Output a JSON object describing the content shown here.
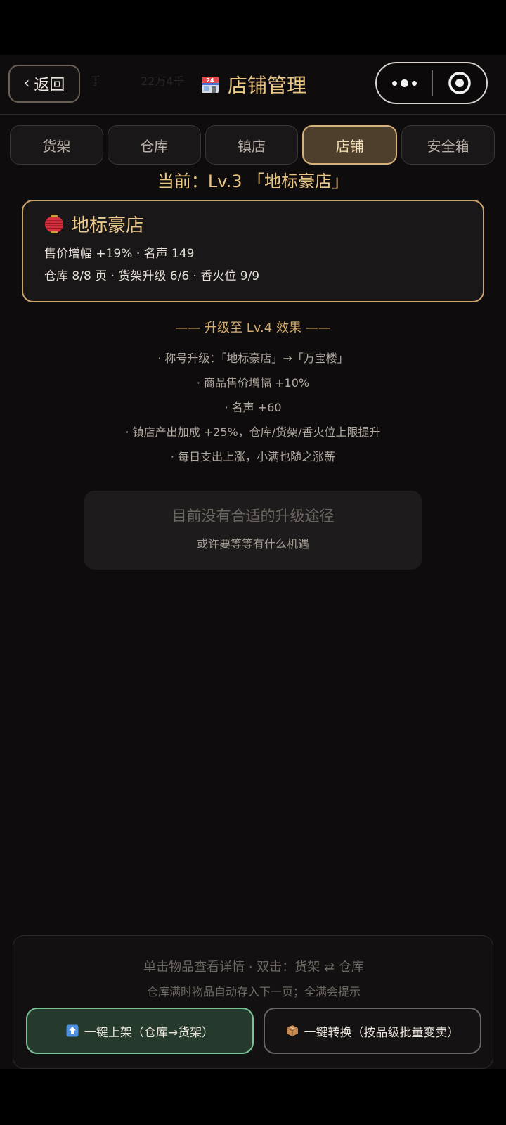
{
  "header": {
    "back_label": "返回",
    "title": "店铺管理",
    "behind_text_1": "手",
    "behind_text_2": "22万4千"
  },
  "tabs": [
    {
      "label": "货架",
      "active": false
    },
    {
      "label": "仓库",
      "active": false
    },
    {
      "label": "镇店",
      "active": false
    },
    {
      "label": "店铺",
      "active": true
    },
    {
      "label": "安全箱",
      "active": false
    }
  ],
  "current_level": "当前：Lv.3 「地标豪店」",
  "shop_card": {
    "name": "地标豪店",
    "stats_line1": "售价增幅 +19% · 名声 149",
    "stats_line2": "仓库 8/8 页 · 货架升级 6/6 · 香火位 9/9"
  },
  "upgrade": {
    "heading": "—— 升级至 Lv.4 效果 ——",
    "effects": [
      "· 称号升级：「地标豪店」→「万宝楼」",
      "· 商品售价增幅 +10%",
      "· 名声 +60",
      "· 镇店产出加成 +25%，仓库/货架/香火位上限提升",
      "· 每日支出上涨，小满也随之涨薪"
    ]
  },
  "no_path": {
    "title": "目前没有合适的升级途径",
    "subtitle": "或许要等等有什么机遇"
  },
  "bottom": {
    "hint1": "单击物品查看详情 · 双击：货架 ⇄ 仓库",
    "hint2": "仓库满时物品自动存入下一页；全满会提示",
    "shelve_label": "一键上架（仓库→货架）",
    "convert_label": "一键转换（按品级批量变卖）"
  },
  "icons": {
    "back": "chevron-left-icon",
    "title": "store-24-icon",
    "shop": "red-lantern-icon",
    "more": "more-dots-icon",
    "close": "target-circle-icon",
    "shelve": "up-arrow-box-icon",
    "convert": "package-icon"
  },
  "colors": {
    "accent_gold": "#e9c684",
    "active_tab_bg": "#4d3f2c",
    "green_button_border": "#7cc098",
    "background": "#0f0c0d"
  }
}
